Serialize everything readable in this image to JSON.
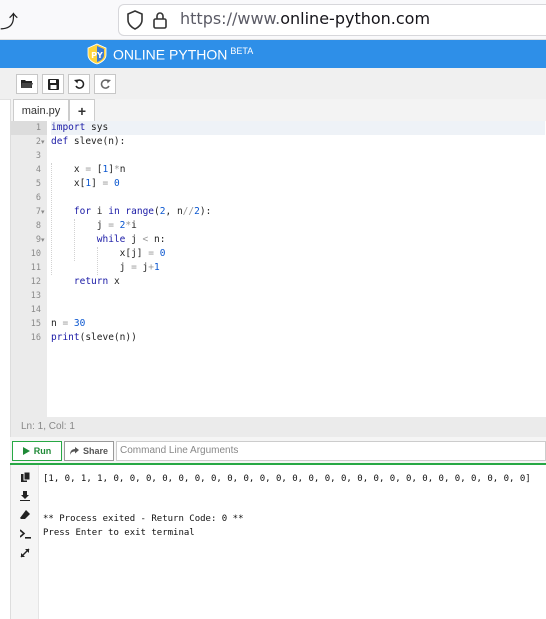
{
  "browser": {
    "url_prefix": "https://www.",
    "url_domain": "online-python.com"
  },
  "app": {
    "title": "ONLINE PYTHON",
    "badge": "BETA",
    "accent": "#2e8fe8"
  },
  "toolbar": {
    "icons": [
      "folder-open-icon",
      "save-icon",
      "undo-icon",
      "redo-icon"
    ]
  },
  "tabs": {
    "file": "main.py",
    "add": "+"
  },
  "editor": {
    "line_numbers": [
      "1",
      "2",
      "3",
      "4",
      "5",
      "6",
      "7",
      "8",
      "9",
      "10",
      "11",
      "12",
      "13",
      "14",
      "15",
      "16"
    ],
    "status": "Ln: 1,  Col: 1"
  },
  "runbar": {
    "run_label": "Run",
    "share_label": "Share",
    "args_placeholder": "Command Line Arguments",
    "run_color": "#27a844"
  },
  "terminal": {
    "icons": [
      "copy-icon",
      "download-icon",
      "eraser-icon",
      "terminal-icon",
      "expand-icon"
    ],
    "output": "[1, 0, 1, 1, 0, 0, 0, 0, 0, 0, 0, 0, 0, 0, 0, 0, 0, 0, 0, 0, 0, 0, 0, 0, 0, 0, 0, 0, 0, 0]",
    "exit_message": "** Process exited - Return Code: 0 **",
    "prompt": "Press Enter to exit terminal"
  }
}
